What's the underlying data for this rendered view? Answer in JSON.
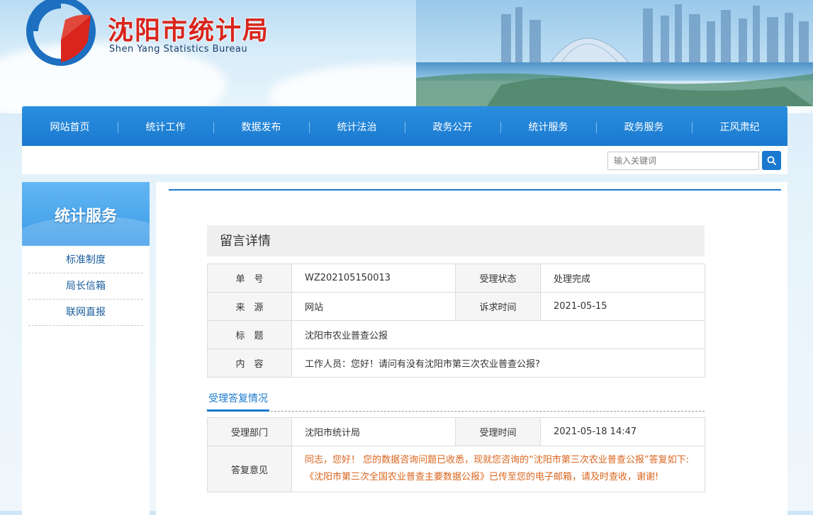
{
  "header": {
    "title": "沈阳市统计局",
    "subtitle": "Shen Yang Statistics Bureau"
  },
  "nav": {
    "items": [
      "网站首页",
      "统计工作",
      "数据发布",
      "统计法治",
      "政务公开",
      "统计服务",
      "政务服务",
      "正风肃纪"
    ]
  },
  "search": {
    "placeholder": "输入关键词",
    "icon": "search-icon"
  },
  "sidebar": {
    "title": "统计服务",
    "items": [
      "标准制度",
      "局长信箱",
      "联网直报"
    ]
  },
  "detail": {
    "heading": "留言详情",
    "rows": {
      "number_label": "单　号",
      "number_value": "WZ202105150013",
      "status_label": "受理状态",
      "status_value": "处理完成",
      "source_label": "来　源",
      "source_value": "网站",
      "request_time_label": "诉求时间",
      "request_time_value": "2021-05-15",
      "subject_label": "标　题",
      "subject_value": "沈阳市农业普查公报",
      "content_label": "内　容",
      "content_value": "工作人员：您好！请问有没有沈阳市第三次农业普查公报?"
    }
  },
  "reply": {
    "tab_label": "受理答复情况",
    "dept_label": "受理部门",
    "dept_value": "沈阳市统计局",
    "time_label": "受理时间",
    "time_value": "2021-05-18 14:47",
    "opinion_label": "答复意见",
    "opinion_line1": "同志，您好！ 您的数据咨询问题已收悉，现就您咨询的“沈阳市第三次农业普查公报”答复如下:",
    "opinion_line2": "《沈阳市第三次全国农业普查主要数据公报》已传至您的电子邮箱，请及时查收，谢谢!"
  },
  "colors": {
    "brand_blue": "#1a79cf",
    "title_red": "#d9251c",
    "answer_orange": "#d9641c"
  }
}
